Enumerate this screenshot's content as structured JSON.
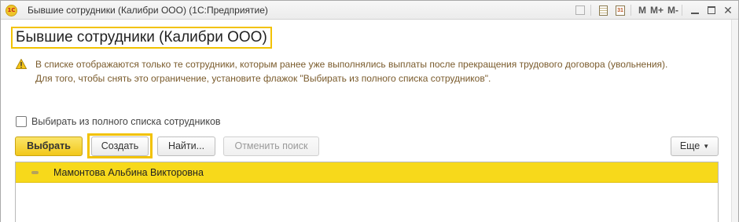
{
  "window": {
    "title": "Бывшие сотрудники (Калибри ООО)  (1С:Предприятие)",
    "logo_text": "1С",
    "toolbar": {
      "icons": [
        "star-icon",
        "document-icon",
        "calendar-icon"
      ],
      "calendar_digit": "31",
      "memory_labels": [
        "M",
        "M+",
        "M-"
      ],
      "window_controls": [
        "minimize-icon",
        "maximize-icon",
        "close-icon"
      ]
    }
  },
  "form": {
    "title": "Бывшие сотрудники (Калибри ООО)",
    "warning": {
      "line1": "В списке отображаются только те сотрудники, которым ранее уже выполнялись выплаты после прекращения трудового договора (увольнения).",
      "line2": "Для того, чтобы снять это ограничение, установите флажок \"Выбирать из полного списка сотрудников\"."
    },
    "checkbox": {
      "label": "Выбирать из полного списка сотрудников",
      "checked": false
    },
    "buttons": {
      "select": "Выбрать",
      "create": "Создать",
      "find": "Найти...",
      "cancel_search": "Отменить поиск",
      "more": "Еще"
    },
    "list": {
      "rows": [
        {
          "name": "Мамонтова Альбина Викторовна",
          "selected": true
        }
      ]
    }
  },
  "colors": {
    "accent_yellow": "#f2c200",
    "selected_row": "#f7d91b",
    "warning_text": "#7a5b2c",
    "primary_button": "#f2c81a"
  }
}
